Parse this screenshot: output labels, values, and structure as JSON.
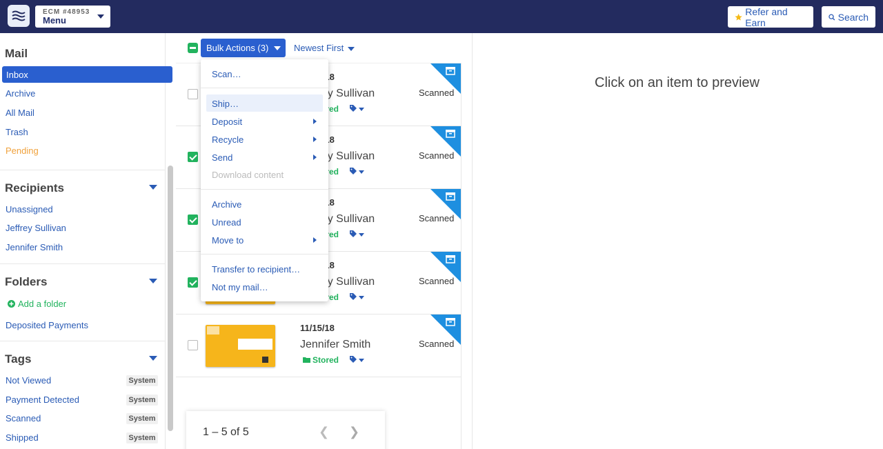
{
  "topbar": {
    "account": "ECM #48953",
    "menu_label": "Menu",
    "refer_label": "Refer and Earn",
    "search_label": "Search"
  },
  "sidebar": {
    "mail_title": "Mail",
    "mail_items": [
      "Inbox",
      "Archive",
      "All Mail",
      "Trash",
      "Pending"
    ],
    "recipients_title": "Recipients",
    "recipients": [
      "Unassigned",
      "Jeffrey Sullivan",
      "Jennifer Smith"
    ],
    "folders_title": "Folders",
    "add_folder": "Add a folder",
    "folders": [
      "Deposited Payments"
    ],
    "tags_title": "Tags",
    "tags": [
      {
        "label": "Not Viewed",
        "badge": "System"
      },
      {
        "label": "Payment Detected",
        "badge": "System"
      },
      {
        "label": "Scanned",
        "badge": "System"
      },
      {
        "label": "Shipped",
        "badge": "System"
      }
    ]
  },
  "list": {
    "bulk_label": "Bulk Actions (3)",
    "sort_label": "Newest First",
    "rows": [
      {
        "date": "11/15/18",
        "name": "Jeffrey Sullivan",
        "stored": "Stored",
        "status": "Scanned",
        "checked": false
      },
      {
        "date": "11/15/18",
        "name": "Jeffrey Sullivan",
        "stored": "Stored",
        "status": "Scanned",
        "checked": true
      },
      {
        "date": "11/15/18",
        "name": "Jeffrey Sullivan",
        "stored": "Stored",
        "status": "Scanned",
        "checked": true
      },
      {
        "date": "11/15/18",
        "name": "Jeffrey Sullivan",
        "stored": "Stored",
        "status": "Scanned",
        "checked": true
      },
      {
        "date": "11/15/18",
        "name": "Jennifer Smith",
        "stored": "Stored",
        "status": "Scanned",
        "checked": false
      }
    ],
    "pager_text": "1 – 5 of 5"
  },
  "dropdown": {
    "items": [
      "Scan…",
      "Ship…",
      "Deposit",
      "Recycle",
      "Send",
      "Download content",
      "Archive",
      "Unread",
      "Move to",
      "Transfer to recipient…",
      "Not my mail…"
    ]
  },
  "preview": {
    "message": "Click on an item to preview"
  },
  "colors": {
    "topbar": "#232b5f",
    "accent": "#2a5fcf",
    "stored": "#22b35e",
    "pending": "#f0a23d"
  }
}
